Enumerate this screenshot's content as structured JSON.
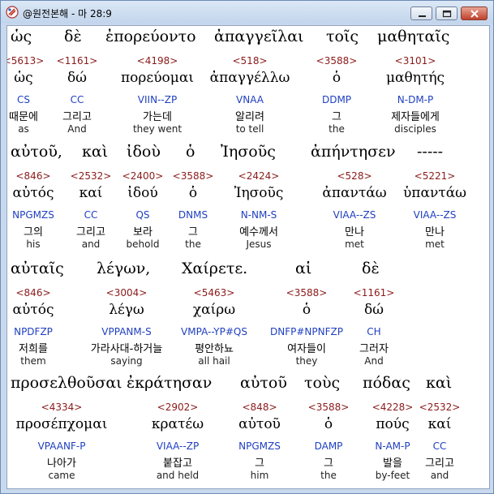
{
  "window": {
    "title": "@원전본해 - 마 28:9",
    "controls": {
      "minimize": "minimize",
      "maximize": "maximize",
      "close": "close"
    }
  },
  "rows": [
    {
      "words": [
        {
          "greek": "ὡς",
          "strong": "<5613>",
          "lemma": "ὡς",
          "parse": "CS",
          "korean": "때문에",
          "english": "as"
        },
        {
          "greek": "δὲ",
          "strong": "<1161>",
          "lemma": "δώ",
          "parse": "CC",
          "korean": "그리고",
          "english": "And"
        },
        {
          "greek": "ἐπορεύοντο",
          "strong": "<4198>",
          "lemma": "πορεύομαι",
          "parse": "VIIN--ZP",
          "korean": "가는데",
          "english": "they went"
        },
        {
          "greek": "ἀπαγγεῖλαι",
          "strong": "<518>",
          "lemma": "ἀπαγγέλλω",
          "parse": "VNAA",
          "korean": "알리려",
          "english": "to tell"
        },
        {
          "greek": "τοῖς",
          "strong": "<3588>",
          "lemma": "ὁ",
          "parse": "DDMP",
          "korean": "그",
          "english": "the"
        },
        {
          "greek": "μαθηταῖς",
          "strong": "<3101>",
          "lemma": "μαθητής",
          "parse": "N-DM-P",
          "korean": "제자들에게",
          "english": "disciples"
        }
      ]
    },
    {
      "words": [
        {
          "greek": "αὐτοῦ,",
          "strong": "<846>",
          "lemma": "αὐτός",
          "parse": "NPGMZS",
          "korean": "그의",
          "english": "his"
        },
        {
          "greek": "καὶ",
          "strong": "<2532>",
          "lemma": "καί",
          "parse": "CC",
          "korean": "그리고",
          "english": "and"
        },
        {
          "greek": "ἰδοὺ",
          "strong": "<2400>",
          "lemma": "ἰδού",
          "parse": "QS",
          "korean": "보라",
          "english": "behold"
        },
        {
          "greek": "ὁ",
          "strong": "<3588>",
          "lemma": "ὁ",
          "parse": "DNMS",
          "korean": "그",
          "english": "the"
        },
        {
          "greek": "Ἰησοῦς",
          "strong": "<2424>",
          "lemma": "Ἰησοῦς",
          "parse": "N-NM-S",
          "korean": "예수께서",
          "english": "Jesus"
        },
        {
          "greek": "ἀπήντησεν",
          "strong": "<528>",
          "lemma": "ἀπαντάω",
          "parse": "VIAA--ZS",
          "korean": "만나",
          "english": "met"
        },
        {
          "greek": "-----",
          "strong": "<5221>",
          "lemma": "ὑπαντάω",
          "parse": "VIAA--ZS",
          "korean": "만나",
          "english": "met"
        }
      ]
    },
    {
      "words": [
        {
          "greek": "αὐταῖς",
          "strong": "<846>",
          "lemma": "αὐτός",
          "parse": "NPDFZP",
          "korean": "저희를",
          "english": "them"
        },
        {
          "greek": "λέγων,",
          "strong": "<3004>",
          "lemma": "λέγω",
          "parse": "VPPANM-S",
          "korean": "가라사대-하거늘",
          "english": "saying"
        },
        {
          "greek": "Χαίρετε.",
          "strong": "<5463>",
          "lemma": "χαίρω",
          "parse": "VMPA--YP#QS",
          "korean": "평안하뇨",
          "english": "all hail"
        },
        {
          "greek": "αἱ",
          "strong": "<3588>",
          "lemma": "ὁ",
          "parse": "DNFP#NPNFZP",
          "korean": "여자들이",
          "english": "they"
        },
        {
          "greek": "δὲ",
          "strong": "<1161>",
          "lemma": "δώ",
          "parse": "CH",
          "korean": "그러자",
          "english": "And"
        }
      ]
    },
    {
      "words": [
        {
          "greek": "προσελθοῦσαι",
          "strong": "<4334>",
          "lemma": "προσέπχομαι",
          "parse": "VPAANF-P",
          "korean": "나아가",
          "english": "came"
        },
        {
          "greek": "ἐκράτησαν",
          "strong": "<2902>",
          "lemma": "κρατέω",
          "parse": "VIAA--ZP",
          "korean": "붙잡고",
          "english": "and held"
        },
        {
          "greek": "αὐτοῦ",
          "strong": "<848>",
          "lemma": "αὐτοῦ",
          "parse": "NPGMZS",
          "korean": "그",
          "english": "him"
        },
        {
          "greek": "τοὺς",
          "strong": "<3588>",
          "lemma": "ὁ",
          "parse": "DAMP",
          "korean": "그",
          "english": "the"
        },
        {
          "greek": "πόδας",
          "strong": "<4228>",
          "lemma": "πούς",
          "parse": "N-AM-P",
          "korean": "발을",
          "english": "by-feet"
        },
        {
          "greek": "καὶ",
          "strong": "<2532>",
          "lemma": "καί",
          "parse": "CC",
          "korean": "그리고",
          "english": "and"
        }
      ]
    }
  ]
}
